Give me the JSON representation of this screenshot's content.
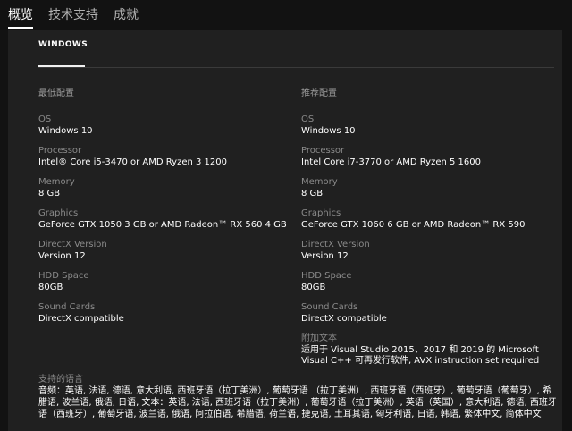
{
  "tabs": [
    {
      "label": "概览"
    },
    {
      "label": "技术支持"
    },
    {
      "label": "成就"
    }
  ],
  "os_tab": "WINDOWS",
  "min": {
    "title": "最低配置",
    "specs": [
      {
        "label": "OS",
        "value": "Windows 10"
      },
      {
        "label": "Processor",
        "value": "Intel® Core i5-3470 or AMD Ryzen 3 1200"
      },
      {
        "label": "Memory",
        "value": "8 GB"
      },
      {
        "label": "Graphics",
        "value": "GeForce GTX 1050 3 GB or AMD Radeon™ RX 560 4 GB"
      },
      {
        "label": "DirectX Version",
        "value": "Version 12"
      },
      {
        "label": "HDD Space",
        "value": "80GB"
      },
      {
        "label": "Sound Cards",
        "value": "DirectX compatible"
      }
    ]
  },
  "rec": {
    "title": "推荐配置",
    "specs": [
      {
        "label": "OS",
        "value": "Windows 10"
      },
      {
        "label": "Processor",
        "value": "Intel Core i7-3770 or AMD Ryzen 5 1600"
      },
      {
        "label": "Memory",
        "value": "8 GB"
      },
      {
        "label": "Graphics",
        "value": "GeForce GTX 1060 6 GB or AMD Radeon™ RX 590"
      },
      {
        "label": "DirectX Version",
        "value": "Version 12"
      },
      {
        "label": "HDD Space",
        "value": "80GB"
      },
      {
        "label": "Sound Cards",
        "value": "DirectX compatible"
      },
      {
        "label": "附加文本",
        "value": "适用于 Visual Studio 2015、2017 和 2019 的 Microsoft Visual C++ 可再发行软件, AVX instruction set required"
      }
    ]
  },
  "languages": {
    "label": "支持的语言",
    "value": "音频：英语, 法语, 德语, 意大利语, 西班牙语（拉丁美洲）, 葡萄牙语 （拉丁美洲）, 西班牙语（西班牙）, 葡萄牙语（葡萄牙）, 希腊语, 波兰语, 俄语, 日语, 文本：英语, 法语, 西班牙语（拉丁美洲）, 葡萄牙语（拉丁美洲）, 英语（英国）, 意大利语, 德语, 西班牙语（西班牙）, 葡萄牙语, 波兰语, 俄语, 阿拉伯语, 希腊语, 荷兰语, 捷克语, 土耳其语, 匈牙利语, 日语, 韩语, 繁体中文, 简体中文"
  }
}
